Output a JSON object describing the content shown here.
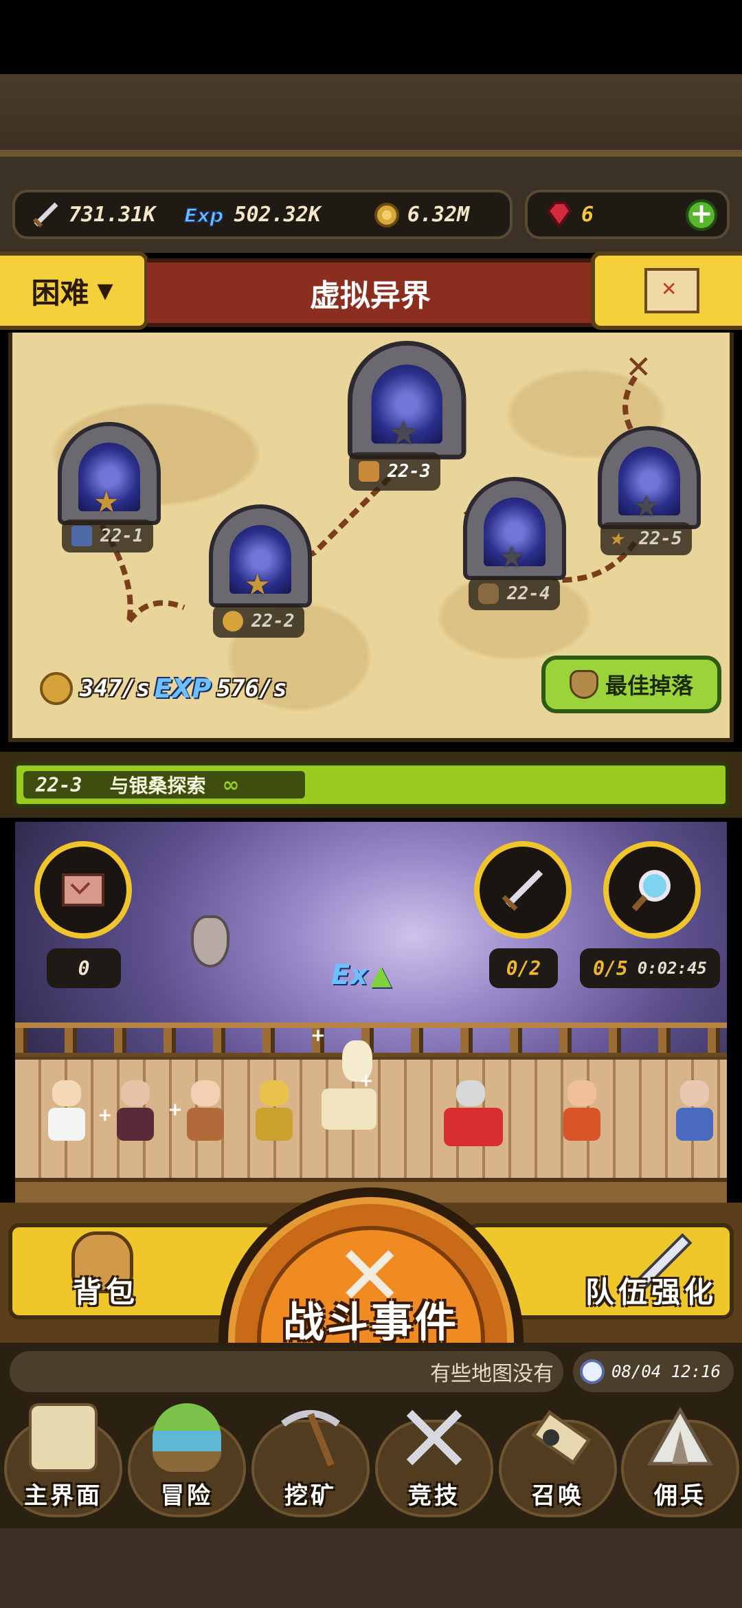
{
  "resources": {
    "attack": "731.31K",
    "exp": "502.32K",
    "gold": "6.32M",
    "ruby": "6"
  },
  "header": {
    "difficulty": "困难",
    "title": "虚拟异界"
  },
  "map": {
    "stages": [
      {
        "label": "22-1"
      },
      {
        "label": "22-2"
      },
      {
        "label": "22-3"
      },
      {
        "label": "22-4"
      },
      {
        "label": "22-5"
      }
    ],
    "gold_rate": "347/s",
    "exp_badge": "EXP",
    "exp_rate": "576/s",
    "best_drop": "最佳掉落"
  },
  "stage_bar": {
    "stage": "22-3",
    "name": "与银桑探索",
    "loop": "∞"
  },
  "battle": {
    "scroll_count": "0",
    "sword_count": "0/2",
    "search_count": "0/5",
    "timer": "0:02:45",
    "exp_buff": "Ex"
  },
  "actions": {
    "backpack": "背包",
    "battle_event": "战斗事件",
    "team_upgrade": "队伍强化"
  },
  "nav": {
    "ticker": "有些地图没有",
    "datetime": "08/04 12:16",
    "items": [
      {
        "label": "主界面"
      },
      {
        "label": "冒险"
      },
      {
        "label": "挖矿"
      },
      {
        "label": "竞技"
      },
      {
        "label": "召唤"
      },
      {
        "label": "佣兵"
      }
    ]
  }
}
